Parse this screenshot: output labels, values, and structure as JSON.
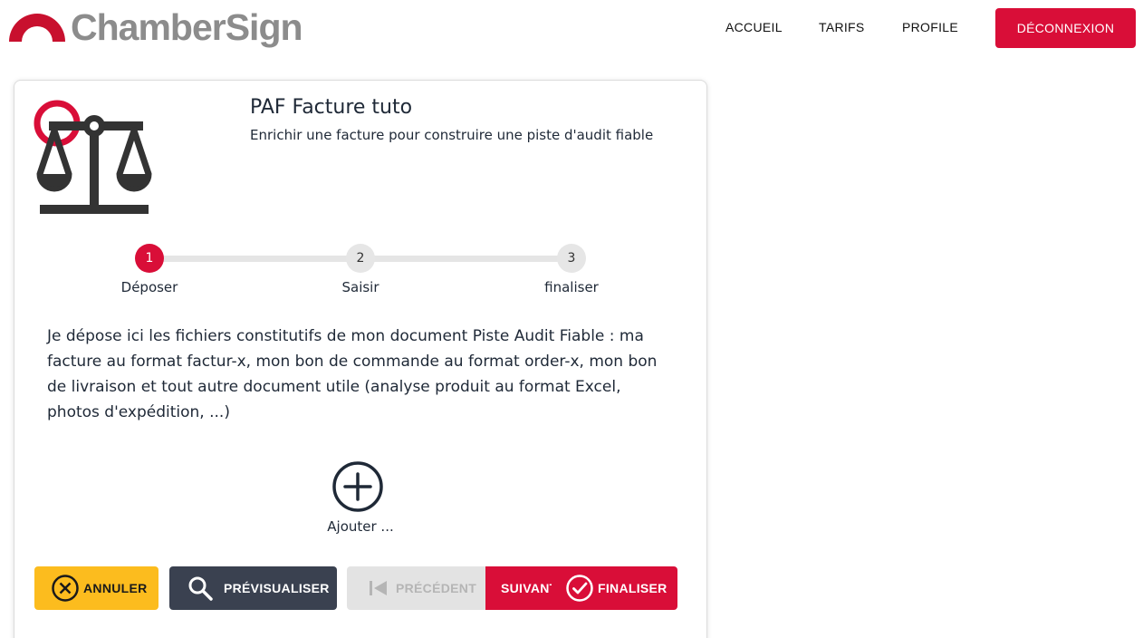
{
  "header": {
    "logo_text": "ChamberSign",
    "nav": [
      "ACCUEIL",
      "TARIFS",
      "PROFILE"
    ],
    "logout_label": "DÉCONNEXION"
  },
  "card": {
    "title": "PAF Facture tuto",
    "subtitle": "Enrichir une facture pour construire une piste d'audit fiable",
    "icon": "balance-scale-icon",
    "steps": [
      {
        "number": "1",
        "label": "Déposer",
        "active": true
      },
      {
        "number": "2",
        "label": "Saisir",
        "active": false
      },
      {
        "number": "3",
        "label": "finaliser",
        "active": false
      }
    ],
    "description": "Je dépose ici les fichiers constitutifs de mon document Piste Audit Fiable : ma facture au format factur-x, mon bon de commande au format order-x, mon bon de livraison et tout autre document utile (analyse produit au format Excel, photos d'expédition, ...)",
    "add_label": "Ajouter ..."
  },
  "actions": {
    "cancel": "ANNULER",
    "preview": "PRÉVISUALISER",
    "previous": "PRÉCÉDENT",
    "next": "SUIVANT",
    "finalize": "FINALISER"
  },
  "colors": {
    "brand_red": "#d90e38",
    "cancel_yellow": "#fcbc1e",
    "preview_dark": "#3a4150",
    "logo_grey": "#8c8c8c"
  }
}
